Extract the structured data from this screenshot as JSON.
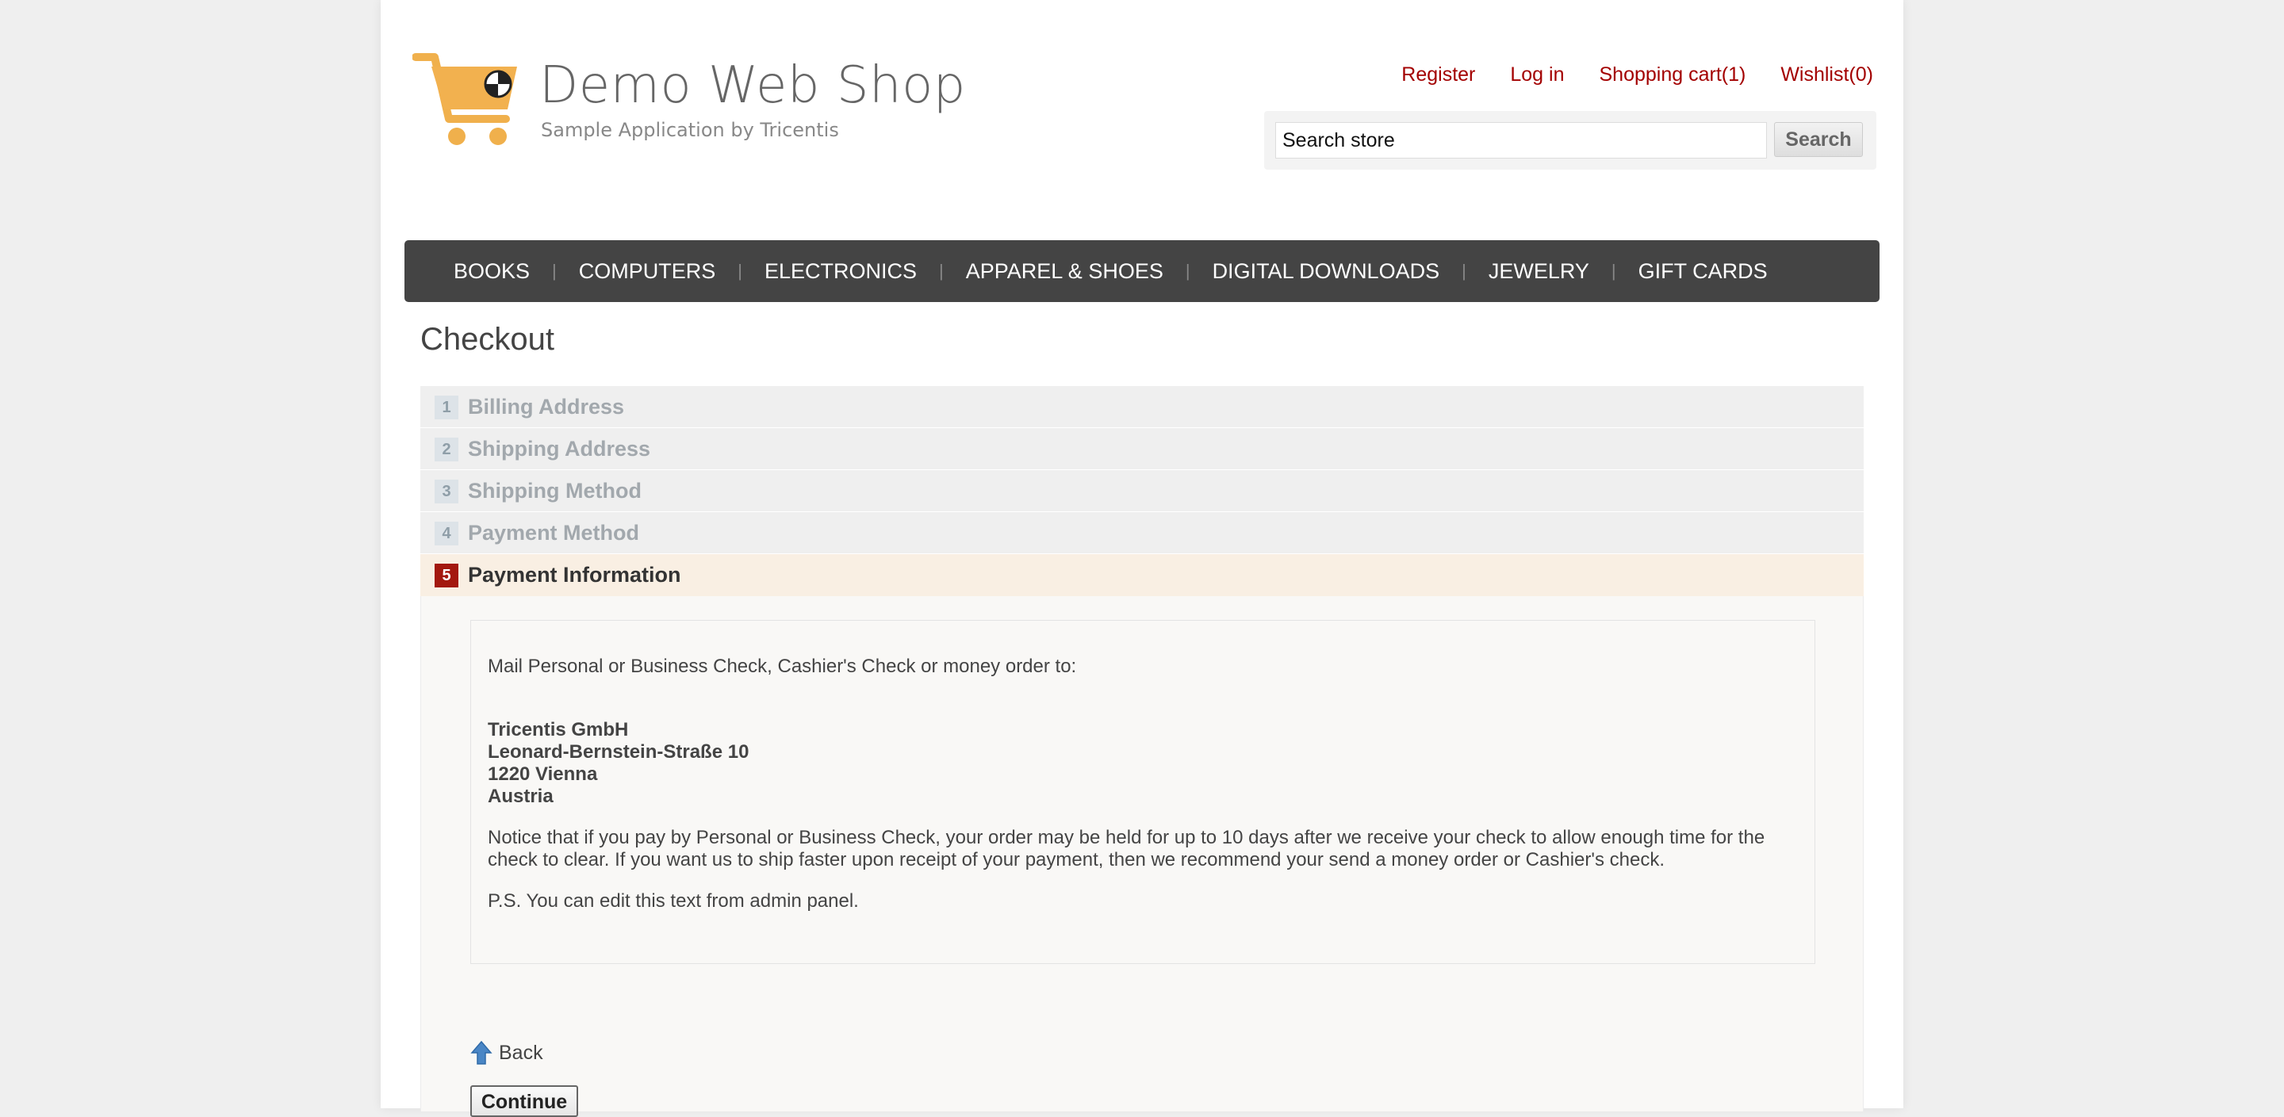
{
  "header": {
    "logo_title": "Demo Web Shop",
    "logo_subtitle": "Sample Application by Tricentis",
    "links": {
      "register": "Register",
      "login": "Log in",
      "cart": "Shopping cart(1)",
      "wishlist": "Wishlist(0)"
    },
    "search": {
      "value": "Search store",
      "button": "Search"
    },
    "link_color": "#a30000"
  },
  "menu": {
    "items": [
      "BOOKS",
      "COMPUTERS",
      "ELECTRONICS",
      "APPAREL & SHOES",
      "DIGITAL DOWNLOADS",
      "JEWELRY",
      "GIFT CARDS"
    ],
    "background": "#444444"
  },
  "checkout": {
    "title": "Checkout",
    "steps": [
      {
        "number": "1",
        "title": "Billing Address"
      },
      {
        "number": "2",
        "title": "Shipping Address"
      },
      {
        "number": "3",
        "title": "Shipping Method"
      },
      {
        "number": "4",
        "title": "Payment Method"
      },
      {
        "number": "5",
        "title": "Payment Information"
      }
    ],
    "active_step": 5,
    "payment_info": {
      "intro": "Mail Personal or Business Check, Cashier's Check or money order to:",
      "address": [
        "Tricentis GmbH",
        "Leonard-Bernstein-Straße 10",
        "1220 Vienna",
        "Austria"
      ],
      "notice_line1": "Notice that if you pay by Personal or Business Check, your order may be held for up to 10 days after we receive your check to allow enough time for the",
      "notice_line2": "check to clear. If you want us to ship faster upon receipt of your payment, then we recommend your send a money order or Cashier's check.",
      "ps": "P.S. You can edit this text from admin panel."
    },
    "back_label": "Back",
    "continue_label": "Continue",
    "active_color": "#a3180f"
  }
}
